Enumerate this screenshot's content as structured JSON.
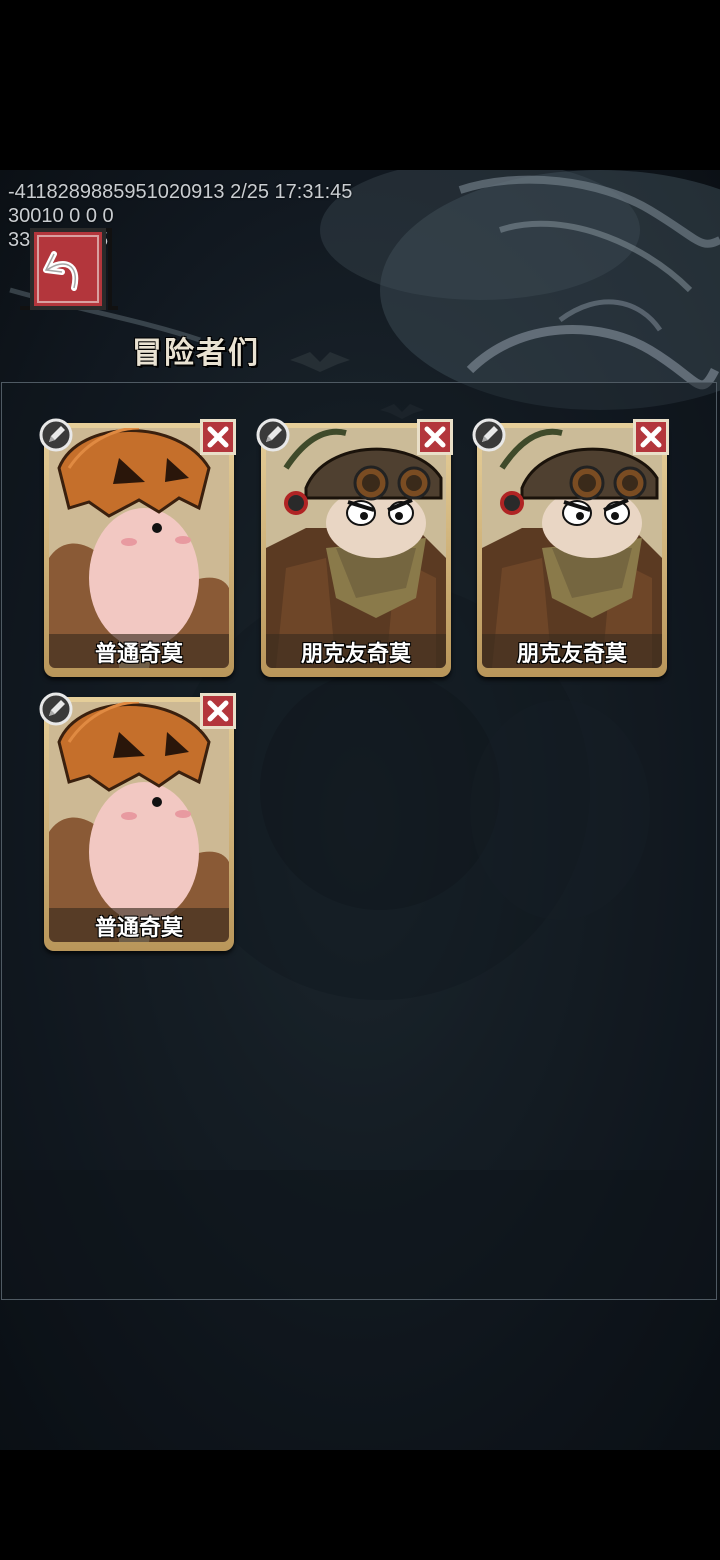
{
  "debug": {
    "line1": "-4118289885951020913 2/25 17:31:45",
    "line2": "30010 0 0 0",
    "line3": "3383 0.5_5"
  },
  "header": {
    "back_icon": "back-arrow-icon",
    "title": "冒险者们"
  },
  "adventurers": [
    {
      "name": "普通奇莫",
      "portrait": "pumpkin-head-portrait",
      "edit_icon": "edit-pen-icon",
      "remove_icon": "close-icon"
    },
    {
      "name": "朋克友奇莫",
      "portrait": "punk-goggles-portrait",
      "edit_icon": "edit-pen-icon",
      "remove_icon": "close-icon"
    },
    {
      "name": "朋克友奇莫",
      "portrait": "punk-goggles-portrait",
      "edit_icon": "edit-pen-icon",
      "remove_icon": "close-icon"
    },
    {
      "name": "普通奇莫",
      "portrait": "pumpkin-head-portrait",
      "edit_icon": "edit-pen-icon",
      "remove_icon": "close-icon"
    }
  ],
  "colors": {
    "card_gold": "#e6cf9a",
    "remove_red": "#b3363c",
    "back_red": "#b3363c"
  }
}
